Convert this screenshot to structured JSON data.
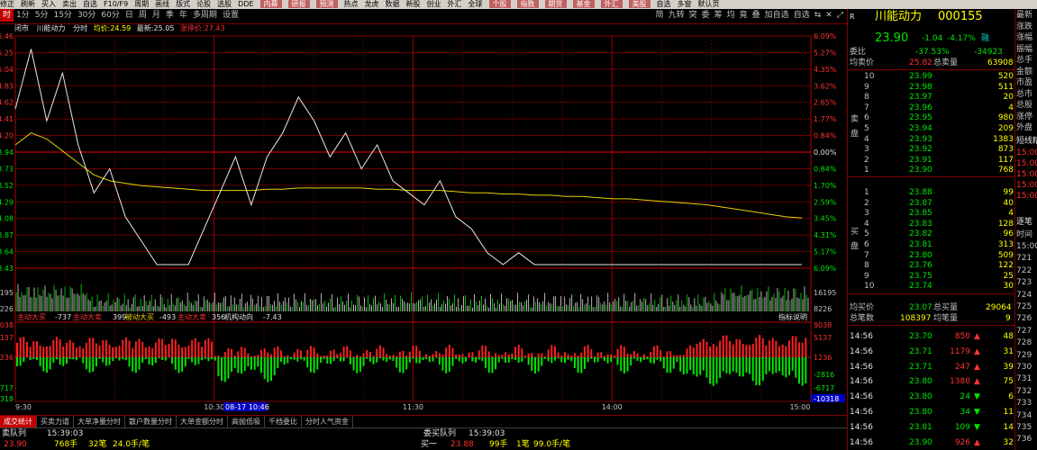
{
  "toolbar": {
    "items": [
      "修正",
      "刷新",
      "买入",
      "卖出",
      "自选",
      "F10/F9",
      "周期",
      "画线",
      "版式",
      "论股",
      "选股",
      "DDE",
      "内幕",
      "研报",
      "预测",
      "热点",
      "龙虎",
      "数据",
      "新股",
      "创业",
      "外汇",
      "全球",
      "个股",
      "指数",
      "期货",
      "基金",
      "外汇",
      "美股",
      "自选",
      "多窗",
      "默认页"
    ]
  },
  "period": {
    "tabs": [
      "时",
      "1分",
      "5分",
      "15分",
      "30分",
      "60分",
      "日",
      "周",
      "月",
      "季",
      "年",
      "多周期",
      "设置"
    ],
    "right_tools": [
      "简",
      "九转",
      "突",
      "委",
      "筹",
      "均",
      "竟",
      "叠",
      "加自选",
      "自选",
      "⇆",
      "✕",
      "⤢"
    ]
  },
  "info": {
    "label_state": "闭市",
    "stock_name": "川能动力",
    "chart_kind": "分时",
    "avg_label": "均价:",
    "avg_value": "24.59",
    "latest_label": "最新:",
    "latest_value": "25.05",
    "limit_label": "涨停价:",
    "limit_value": "27.43"
  },
  "axes": {
    "price_left": [
      "5.46",
      "5.25",
      "5.04",
      "4.83",
      "4.62",
      "4.41",
      "4.20",
      "3.99",
      "3.78",
      "3.57",
      "3.36",
      "3.15",
      "2.94"
    ],
    "pct_right": [
      "6.09%",
      "5.27%",
      "4.35%",
      "3.62%",
      "2.65%",
      "1.77%",
      "0.84%",
      "0.00%",
      "0.84%",
      "1.70%",
      "2.59%",
      "3.45%",
      "4.31%",
      "5.17%",
      "6.09%"
    ],
    "price_left_full": [
      "5.46",
      "5.25",
      "5.04",
      "4.83",
      "4.62",
      "4.41",
      "4.20",
      "3.94",
      "3.73",
      "3.52",
      "4.29",
      "4.08",
      "3.87",
      "3.64",
      "3.43"
    ],
    "vol_left": [
      "195",
      "226"
    ],
    "vol_right": [
      "16195",
      "8226"
    ],
    "flow_left": [
      "038",
      "137",
      "236",
      "",
      "717",
      "318"
    ],
    "flow_right": [
      "9038",
      "5137",
      "1236",
      "-2816",
      "-6717",
      "-10318"
    ],
    "time_labels": [
      "9:30",
      "10:30",
      "11:30",
      "14:00",
      "15:00"
    ],
    "cursor_time": "08-17 10:46",
    "cursor_value": "-10318"
  },
  "flow_line": {
    "main_big_label": "主动大买",
    "main_big_value": "-737",
    "main_big_sell_label": "主动大卖",
    "main_big_sell_value": "399",
    "passive_buy_label": "被动大买",
    "passive_buy_value": "-493",
    "main_sell2_label": "主动大卖",
    "main_sell2_value": "356",
    "inst_label": "机构动向",
    "inst_value": "-7.43",
    "help_label": "指标说明"
  },
  "bottom_tabs": [
    "成交统计",
    "买卖力道",
    "大单净量分时",
    "散户数量分时",
    "大单金额分时",
    "高抛低吸",
    "千档委比",
    "分时人气资金"
  ],
  "queue": {
    "sell_label": "卖队列",
    "sell_time": "15:39:03",
    "buy_label": "委买队列",
    "buy_time": "15:39:03",
    "row_left": [
      "23.90",
      "768手",
      "32笔",
      "24.0手/笔"
    ],
    "row_right": [
      "买一",
      "23.88",
      "99手",
      "1笔",
      "99.0手/笔"
    ]
  },
  "quote": {
    "flag": "R",
    "name": "川能动力",
    "code": "000155",
    "price": "23.90",
    "change": "-1.04",
    "change_pct": "-4.17%",
    "tag": "融",
    "commit_ratio_label": "委比",
    "commit_ratio": "-37.53%",
    "commit_diff": "-34923",
    "avg_sell_label": "均卖价",
    "avg_sell": "25.82",
    "total_sell_label": "总卖量",
    "total_sell": "63908",
    "sell_side_label": "卖盘",
    "buy_side_label": "买盘",
    "sell_levels": [
      {
        "n": "10",
        "p": "23.99",
        "v": "520"
      },
      {
        "n": "9",
        "p": "23.98",
        "v": "511"
      },
      {
        "n": "8",
        "p": "23.97",
        "v": "20"
      },
      {
        "n": "7",
        "p": "23.96",
        "v": "4"
      },
      {
        "n": "6",
        "p": "23.95",
        "v": "980"
      },
      {
        "n": "5",
        "p": "23.94",
        "v": "209"
      },
      {
        "n": "4",
        "p": "23.93",
        "v": "1383"
      },
      {
        "n": "3",
        "p": "23.92",
        "v": "873"
      },
      {
        "n": "2",
        "p": "23.91",
        "v": "117"
      },
      {
        "n": "1",
        "p": "23.90",
        "v": "768"
      }
    ],
    "buy_levels": [
      {
        "n": "1",
        "p": "23.88",
        "v": "99"
      },
      {
        "n": "2",
        "p": "23.87",
        "v": "40"
      },
      {
        "n": "3",
        "p": "23.85",
        "v": "4"
      },
      {
        "n": "4",
        "p": "23.83",
        "v": "128"
      },
      {
        "n": "5",
        "p": "23.82",
        "v": "96"
      },
      {
        "n": "6",
        "p": "23.81",
        "v": "313"
      },
      {
        "n": "7",
        "p": "23.80",
        "v": "509"
      },
      {
        "n": "8",
        "p": "23.76",
        "v": "122"
      },
      {
        "n": "9",
        "p": "23.75",
        "v": "25"
      },
      {
        "n": "10",
        "p": "23.74",
        "v": "30"
      }
    ],
    "avg_buy_label": "均买价",
    "avg_buy": "23.07",
    "total_buy_label": "总买量",
    "total_buy": "29064",
    "total_count_label": "总笔数",
    "total_count": "108397",
    "avg_count_label": "均笔量",
    "avg_count": "9",
    "ticks": [
      {
        "t": "14:56",
        "p": "23.70",
        "v": "850",
        "dir": "up",
        "n": "48"
      },
      {
        "t": "14:56",
        "p": "23.71",
        "v": "1179",
        "dir": "up",
        "n": "31"
      },
      {
        "t": "14:56",
        "p": "23.71",
        "v": "247",
        "dir": "up",
        "n": "39"
      },
      {
        "t": "14:56",
        "p": "23.80",
        "v": "1380",
        "dir": "up",
        "n": "75"
      },
      {
        "t": "14:56",
        "p": "23.80",
        "v": "24",
        "dir": "down",
        "n": "6"
      },
      {
        "t": "14:56",
        "p": "23.80",
        "v": "34",
        "dir": "down",
        "n": "11"
      },
      {
        "t": "14:56",
        "p": "23.81",
        "v": "109",
        "dir": "down",
        "n": "14"
      },
      {
        "t": "14:56",
        "p": "23.90",
        "v": "926",
        "dir": "up",
        "n": "32"
      }
    ]
  },
  "far_right": {
    "labels": [
      "最新",
      "涨跌",
      "涨幅",
      "振幅",
      "总手",
      "金额",
      "市盈",
      "总市",
      "总股",
      "涨停",
      "外盘"
    ],
    "section1": "短线精",
    "times1": [
      "15:00",
      "15:00",
      "15:00",
      "15:00",
      "15:00"
    ],
    "section2": "逐笔",
    "sub2": "时间",
    "times2": [
      "15:00",
      "721",
      "722",
      "723",
      "724",
      "725",
      "726",
      "727",
      "728",
      "729",
      "730",
      "731",
      "732",
      "733",
      "734",
      "735",
      "736"
    ]
  },
  "chart_data": {
    "type": "line",
    "title": "",
    "x_labels": [
      "9:30",
      "10:30",
      "11:30",
      "14:00",
      "15:00"
    ],
    "price_range": [
      22.42,
      27.43
    ],
    "pre_close": 24.94,
    "price_series_note": "分时价格线(白)与均价线(黄)",
    "price": [
      25.3,
      25.8,
      25.2,
      25.6,
      25.0,
      24.6,
      24.8,
      24.4,
      24.2,
      24.0,
      23.6,
      23.8,
      24.3,
      24.6,
      24.9,
      24.5,
      24.9,
      25.1,
      25.4,
      25.2,
      24.9,
      25.1,
      24.8,
      25.0,
      24.7,
      24.6,
      24.5,
      24.7,
      24.4,
      24.3,
      24.1,
      24.0,
      24.1,
      23.9,
      23.7,
      23.6,
      23.8,
      23.6,
      23.4,
      23.3,
      23.2,
      23.4,
      23.6,
      23.4,
      23.2,
      23.0,
      22.9,
      23.0,
      23.3,
      23.5,
      23.6
    ],
    "avg": [
      25.0,
      25.1,
      25.05,
      24.95,
      24.85,
      24.75,
      24.7,
      24.68,
      24.66,
      24.65,
      24.64,
      24.63,
      24.62,
      24.62,
      24.62,
      24.62,
      24.63,
      24.63,
      24.64,
      24.64,
      24.64,
      24.64,
      24.64,
      24.63,
      24.63,
      24.62,
      24.62,
      24.62,
      24.61,
      24.6,
      24.6,
      24.59,
      24.59,
      24.58,
      24.58,
      24.57,
      24.57,
      24.56,
      24.55,
      24.55,
      24.54,
      24.53,
      24.52,
      24.51,
      24.5,
      24.48,
      24.46,
      24.44,
      24.42,
      24.4,
      24.39
    ]
  }
}
